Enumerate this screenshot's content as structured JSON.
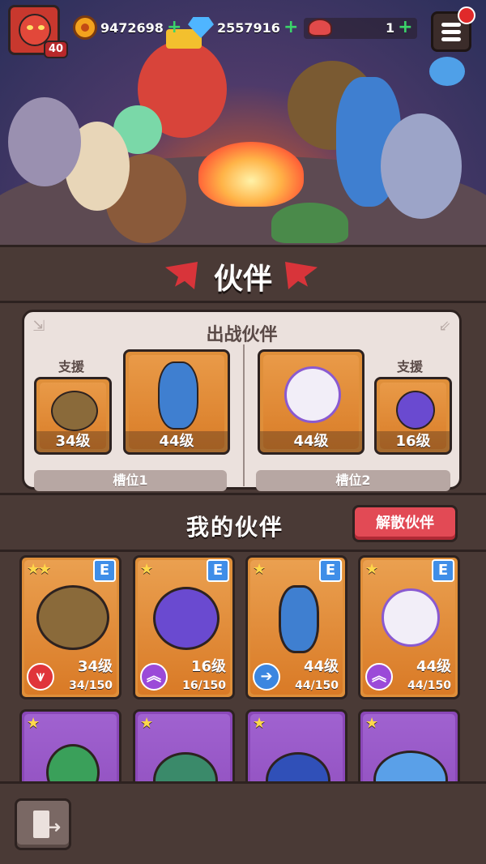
{
  "player": {
    "level": "40"
  },
  "resources": {
    "coins": "9472698",
    "gems": "2557916",
    "tokens": "1"
  },
  "title": "伙伴",
  "battle_panel": {
    "title": "出战伙伴",
    "support_label": "支援",
    "slot1": {
      "label": "槽位1",
      "support_level": "34级",
      "main_level": "44级"
    },
    "slot2": {
      "label": "槽位2",
      "main_level": "44级",
      "support_level": "16级"
    }
  },
  "my_partners": {
    "title": "我的伙伴",
    "dismiss_label": "解散伙伴",
    "cards": [
      {
        "stars": "★★",
        "rank": "E",
        "level": "34级",
        "exp": "34/150",
        "type_color": "#e0343a",
        "type_glyph": "⩛"
      },
      {
        "stars": "★",
        "rank": "E",
        "level": "16级",
        "exp": "16/150",
        "type_color": "#9b4ad8",
        "type_glyph": "︽"
      },
      {
        "stars": "★",
        "rank": "E",
        "level": "44级",
        "exp": "44/150",
        "type_color": "#3b86e0",
        "type_glyph": "➔"
      },
      {
        "stars": "★",
        "rank": "E",
        "level": "44级",
        "exp": "44/150",
        "type_color": "#9b4ad8",
        "type_glyph": "︽"
      }
    ],
    "row2_stars": [
      "★",
      "★",
      "★",
      "★"
    ]
  },
  "colors": {
    "orange_card": "#df8f3a",
    "purple_card": "#8a48b8",
    "dismiss_button": "#e24a55",
    "panel_bg": "#ebe1dd"
  }
}
